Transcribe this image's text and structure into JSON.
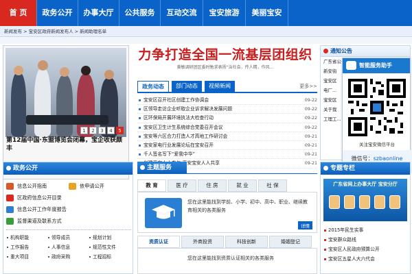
{
  "nav": {
    "items": [
      "首 页",
      "政务公开",
      "办事大厅",
      "公共服务",
      "互动交流",
      "宝安旅游",
      "美丽宝安"
    ]
  },
  "breadcrumb": {
    "text": "新闻发布 > 宝安区政府新闻发布人 > 新闻助理名单"
  },
  "photo": {
    "caption": "第12届中国·东盟博览会闭幕，宝企收获颇丰",
    "pages": [
      "1",
      "2",
      "3",
      "4",
      "5"
    ]
  },
  "headline": {
    "title": "力争打造全国一流基层团组织",
    "subtitle": "黄敏调研团区委时勉求表扬“治社会，传人精，作风..."
  },
  "news": {
    "tabs": [
      "政务动态",
      "部门动态",
      "视频新闻"
    ],
    "more": "更多>>",
    "items": [
      {
        "title": "宝安区召开社区创建工作协调会",
        "date": "09-22"
      },
      {
        "title": "区领导走访企业听取企业诉求解决发展问题",
        "date": "09-22"
      },
      {
        "title": "区环保局开展环境执法大检查行动",
        "date": "09-22"
      },
      {
        "title": "宝安区卫生计生系统综合党委召开会议",
        "date": "09-22"
      },
      {
        "title": "宝安等六区合力打造人才高地工作研讨会",
        "date": "09-21"
      },
      {
        "title": "宝安家电行业发展论坛在宝安召开",
        "date": "09-21"
      },
      {
        "title": "千人签名写下“爱我中华”",
        "date": "09-21"
      },
      {
        "title": "创建平安人人参与 平安宝安人人共享",
        "date": "09-21"
      }
    ]
  },
  "notice": {
    "title": "通知公告",
    "lines": [
      "广东省公",
      "新安街",
      "宝安区",
      "电厂...",
      "宝安区",
      "关于我",
      "工理工..."
    ]
  },
  "qr": {
    "title": "智能服务助手",
    "caption": "关注宝安微信平台",
    "account_label": "微信号：",
    "account_id": "szbaonline"
  },
  "open_gov": {
    "title": "政务公开",
    "items": [
      {
        "label": "信息公开指南",
        "color": "#d65a2a"
      },
      {
        "label": "依申请公开",
        "color": "#e7a321"
      },
      {
        "label": "区政府信息公开目录",
        "color": "#d9281f"
      },
      {
        "label": "信息公开工作年度报告",
        "color": "#2f7fd0"
      },
      {
        "label": "监督渠道及联系方式",
        "color": "#3a9d3a"
      }
    ],
    "small_items": [
      "机构职能",
      "领导成员",
      "规划计划",
      "工作报告",
      "人事信息",
      "规范性文件",
      "重大项目",
      "政府采购",
      "工程招标"
    ]
  },
  "theme": {
    "title": "主题服务",
    "tabs": [
      "教 育",
      "医 疗",
      "住 房",
      "就 业",
      "社 保"
    ],
    "desc": "您在这里能找到学前、小学、初中、高中、职业、继续教育相关的各类服务",
    "detail": "详情",
    "tabs2": [
      "资质认证",
      "外商投资",
      "科技创新",
      "婚姻登记"
    ],
    "desc2": "您在这里能找到资质认证相关的各类服务"
  },
  "special": {
    "title": "专题专栏",
    "banner": "广东省网上办事大厅 宝安分厅",
    "items": [
      "2015年民生实事",
      "宝安群众路线",
      "宝安区人民政府预算公开",
      "宝安区五星人大六代会"
    ]
  }
}
